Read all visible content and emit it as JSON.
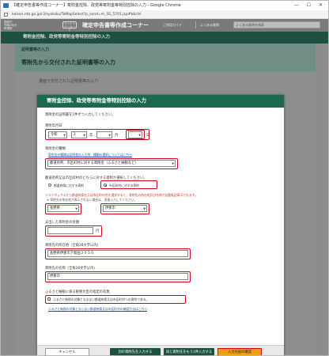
{
  "browser": {
    "title": "【確定申告書等作成コーナー】寄附金控除、政党等寄附金等特別控除の入力 - Google Chrome",
    "url": "keisan.nta.go.jp/r3/syotoku/TaMapSelect?p_send=m_SS_5701.jsp#bbctrl",
    "controls": "—  ☐  ✕"
  },
  "header": {
    "logo_line1": "国税庁",
    "logo_line2": "令和2年分",
    "logo_line3": "所得税",
    "badge": "マイナンバーカード",
    "site_name": "確定申告書等作成コーナー",
    "guide_link": "ご利用ガイド",
    "faq_link": "よくある質問",
    "search_placeholder": "よくある質問を検索"
  },
  "page": {
    "band_title": "寄附金控除、政党等寄附金等特別控除の入力",
    "section_label": "証明書等の入力",
    "section_title": "寄附先から交付された証明書等の入力",
    "body_text": "書面で交付された証明書等の入力"
  },
  "modal": {
    "title": "寄附金控除、政党等寄附金等特別控除の入力",
    "intro": "寄附金の証明書を1件ずつ入力してください。",
    "date": {
      "label": "寄附年月日",
      "era": "令和",
      "year": "2",
      "year_unit": "年",
      "month": "",
      "month_unit": "月",
      "day": "",
      "day_unit": "日"
    },
    "type": {
      "label": "寄附金の種類",
      "link": "寄附金の種類は証明書の入力例、種類の選択についてはこちら",
      "value": "都道府県、市区町村に対する寄附金（ふるさと納税など）"
    },
    "target": {
      "label": "都道府県又は市区町村のどちらに対する寄附か選択してください。",
      "option1": "都道府県に対する寄附",
      "option2": "市区町村に対する寄附",
      "selected": "option2"
    },
    "location": {
      "note": "リストボックスから都道府県名又は市区町村名を選択すると、寄附先の所在地及び名称が自動転記表示されます。",
      "sub_note": "※ 寄附先の所在地が表示されない場合は、直接入力してください。",
      "prefecture": "長野県",
      "city": "伊那市"
    },
    "amount": {
      "label": "支出した寄附金の金額",
      "value": "",
      "unit": "円"
    },
    "address": {
      "label": "寄附先の所在地（全角28文字以内）",
      "value": "長野県伊那市下新田３０５０"
    },
    "name": {
      "label": "寄附先の名称（全角28文字以内）",
      "value": "伊那市"
    },
    "furusato": {
      "label": "ふるさと納税に係る税務大臣の指定の有無",
      "checkbox": "ふるさと納税の対象となるない都道府県又は市区町村への寄附である。",
      "link": "ふるさと納税の対象とならない都道府県又は市区町村の確認方法はこちら"
    },
    "buttons": {
      "cancel": "キャンセル",
      "next": "別の寄附先を入力する",
      "same": "同じ寄附先をもう1件入力する",
      "confirm": "入力内容の確認"
    }
  }
}
